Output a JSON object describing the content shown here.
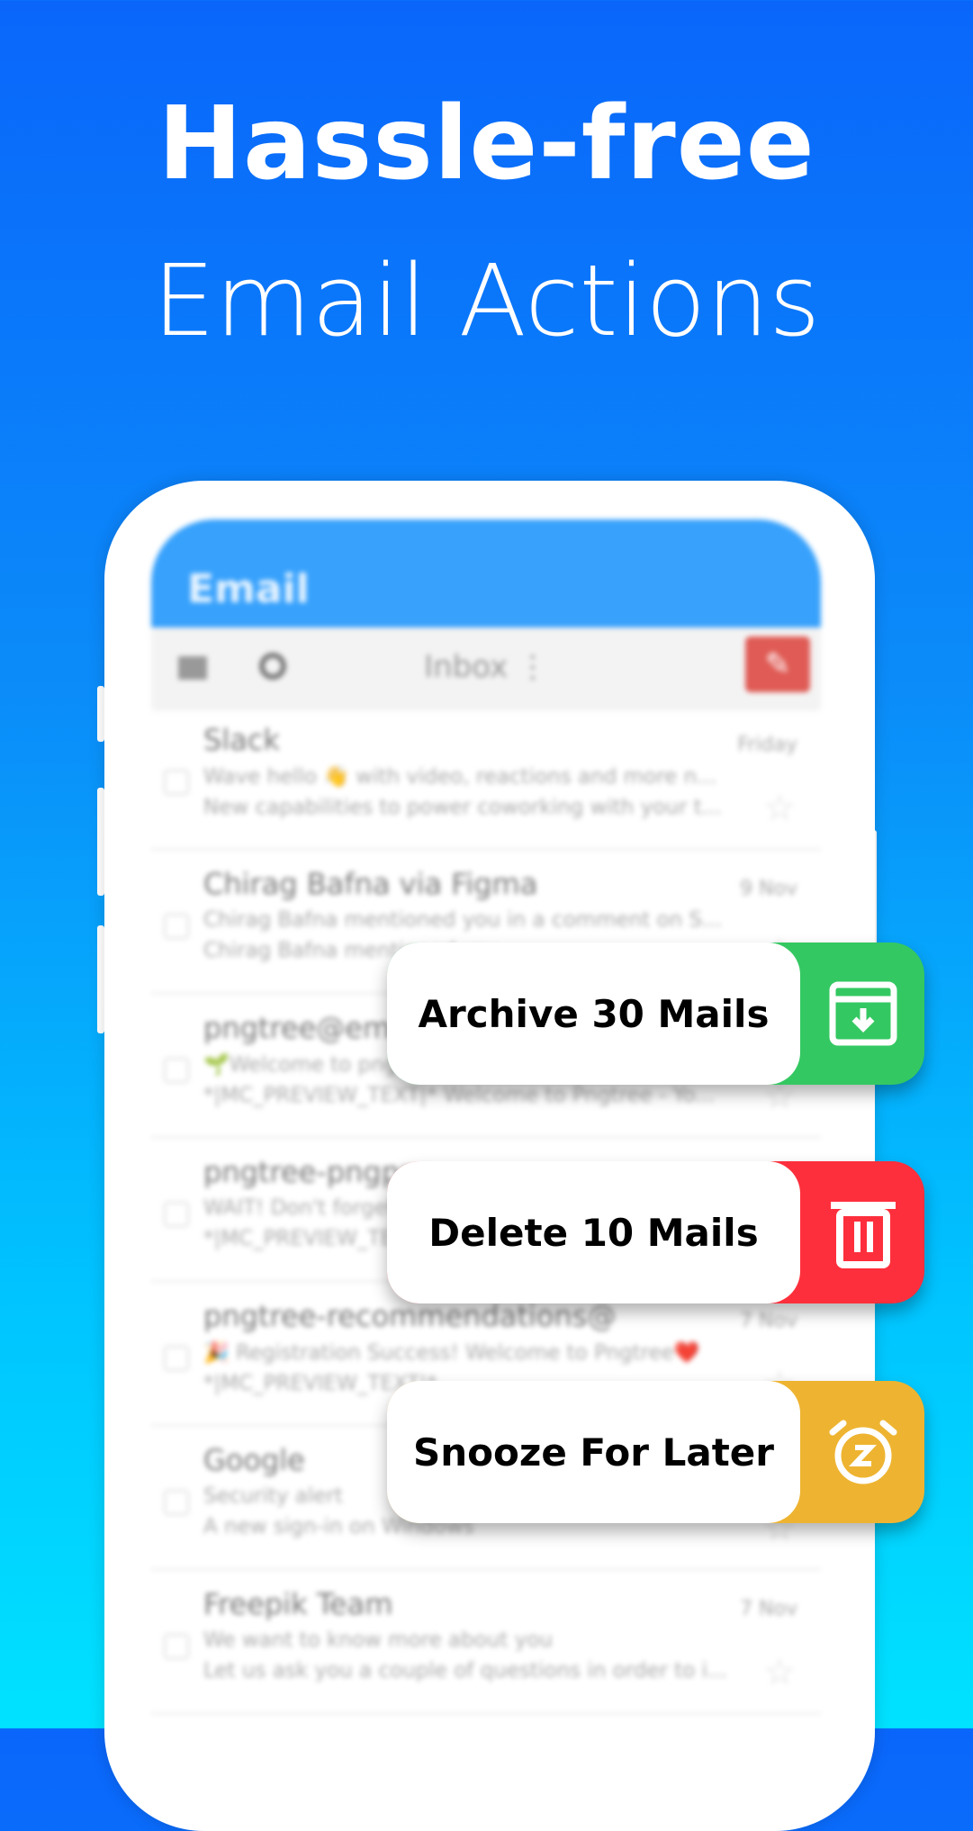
{
  "headline": {
    "line1": "Hassle-free",
    "line2": "Email Actions"
  },
  "app": {
    "title": "Email",
    "toolbar": {
      "folder": "Inbox",
      "folder_icon": "more-vert-icon",
      "compose_icon": "pencil-icon"
    }
  },
  "emails": [
    {
      "from": "Slack",
      "date": "Friday",
      "line1": "Wave hello 👋 with video, reactions and more n...",
      "line2": "New capabilities to power coworking with your t..."
    },
    {
      "from": "Chirag Bafna via Figma",
      "date": "9 Nov",
      "line1": "Chirag Bafna mentioned you in a comment on S...",
      "line2": "Chirag Bafna mentioned you"
    },
    {
      "from": "pngtree@email",
      "date": "",
      "line1": "🌱Welcome to pngtree",
      "line2": "*|MC_PREVIEW_TEXT|* Welcome to Pngtree - Yo..."
    },
    {
      "from": "pngtree-pngpng",
      "date": "",
      "line1": "WAIT! Don't forget",
      "line2": "*|MC_PREVIEW_TEXT|*"
    },
    {
      "from": "pngtree-recommendations@",
      "date": "7 Nov",
      "line1": "🎉 Registration Success! Welcome to Pngtree❤️",
      "line2": "*|MC_PREVIEW_TEXT|*"
    },
    {
      "from": "Google",
      "date": "",
      "line1": "Security alert",
      "line2": "A new sign-in on Windows"
    },
    {
      "from": "Freepik Team",
      "date": "7 Nov",
      "line1": "We want to know more about you",
      "line2": "Let us ask you a couple of questions in order to i..."
    }
  ],
  "actions": [
    {
      "label": "Archive 30 Mails",
      "color": "#34c862",
      "icon": "archive-icon"
    },
    {
      "label": "Delete 10 Mails",
      "color": "#fe2f3c",
      "icon": "trash-icon"
    },
    {
      "label": "Snooze For Later",
      "color": "#eeb431",
      "icon": "alarm-clock-icon"
    }
  ]
}
